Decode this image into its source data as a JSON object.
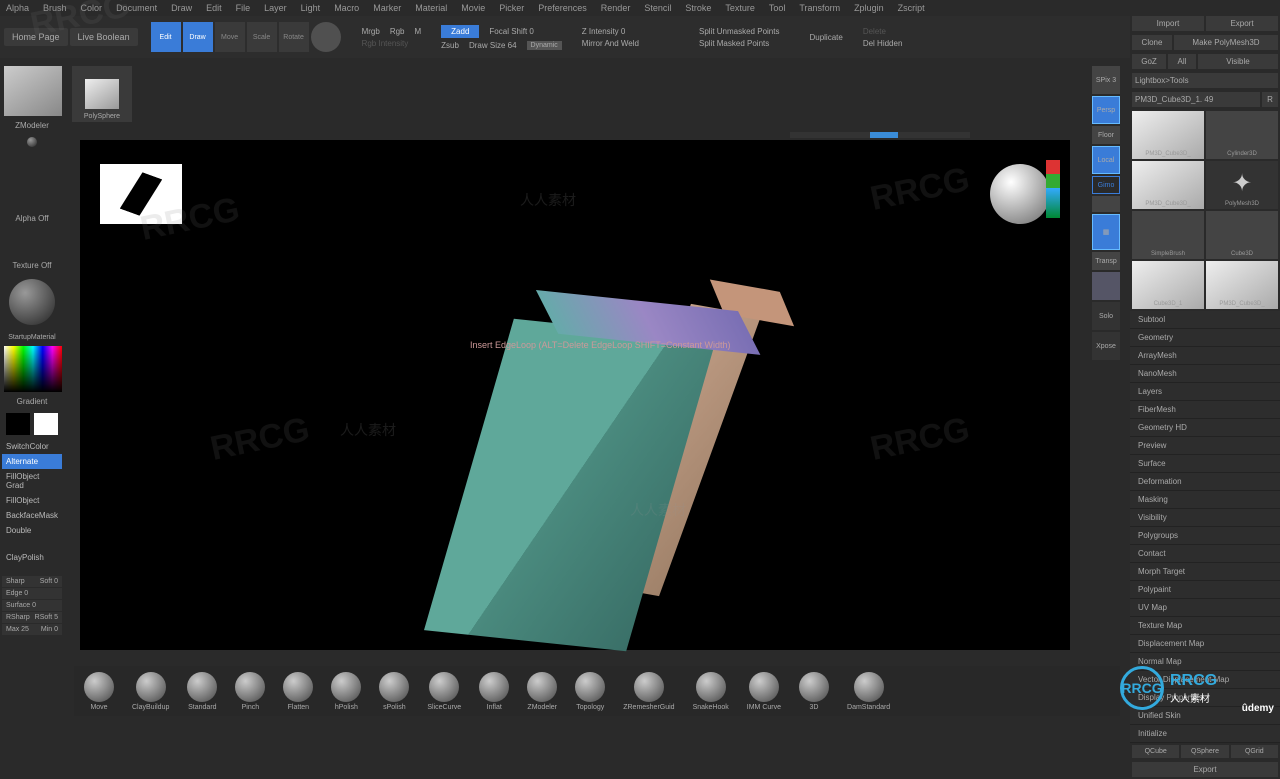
{
  "menu": [
    "Alpha",
    "Brush",
    "Color",
    "Document",
    "Draw",
    "Edit",
    "File",
    "Layer",
    "Light",
    "Macro",
    "Marker",
    "Material",
    "Movie",
    "Picker",
    "Preferences",
    "Render",
    "Stencil",
    "Stroke",
    "Texture",
    "Tool",
    "Transform",
    "Zplugin",
    "Zscript"
  ],
  "topbar": {
    "home": "Home Page",
    "live": "Live Boolean",
    "icons": [
      "Edit",
      "Draw",
      "Move",
      "Scale",
      "Rotate"
    ],
    "active_icons": [
      0,
      1
    ],
    "mrgb": "Mrgb",
    "rgb": "Rgb",
    "m": "M",
    "zadd": "Zadd",
    "zsub": "Zsub",
    "focal": "Focal Shift 0",
    "draw": "Draw Size 64",
    "dynamic": "Dynamic",
    "zint": "Z Intensity 0",
    "mirror": "Mirror And Weld",
    "split1": "Split Unmasked Points",
    "split2": "Split Masked Points",
    "dup": "Duplicate",
    "del": "Delete",
    "delh": "Del Hidden"
  },
  "left": {
    "tool": "ZModeler",
    "poly": "PolySphere",
    "alpha": "Alpha Off",
    "texture": "Texture Off",
    "material": "StartupMaterial",
    "gradient": "Gradient",
    "switch": "SwitchColor",
    "opts": [
      "Alternate",
      "FillObject Grad",
      "FillObject",
      "BackfaceMask",
      "Double"
    ],
    "claypolish": "ClayPolish",
    "sliders": [
      {
        "l": "Sharp",
        "r": "Soft 0"
      },
      {
        "l": "Edge 0",
        "r": ""
      },
      {
        "l": "Surface 0",
        "r": ""
      },
      {
        "l": "RSharp",
        "r": "RSoft 5"
      },
      {
        "l": "Max 25",
        "r": "Min 0"
      }
    ]
  },
  "canvas_tip": "Insert EdgeLoop (ALT=Delete EdgeLoop SHIFT=Constant Width)",
  "right_icons": {
    "spix": "SPix 3",
    "labels": [
      "Persp",
      "Floor",
      "Local",
      "Gimo",
      "Transp",
      "Solo",
      "Xpose"
    ]
  },
  "rightpanel": {
    "import": "Import",
    "export": "Export",
    "clone": "Clone",
    "make": "Make PolyMesh3D",
    "goz": "GoZ",
    "all": "All",
    "visible": "Visible",
    "lightbox": "Lightbox>Tools",
    "subtool": "PM3D_Cube3D_1. 49",
    "r": "R",
    "tools": [
      "PM3D_Cube3D_",
      "Cylinder3D",
      "PM3D_Cube3D_",
      "PolyMesh3D",
      "SimpleBrush",
      "Cube3D",
      "Cube3D_1",
      "PM3D_Cube3D_"
    ],
    "accordion": [
      "Subtool",
      "Geometry",
      "ArrayMesh",
      "NanoMesh",
      "Layers",
      "FiberMesh",
      "Geometry HD",
      "Preview",
      "Surface",
      "Deformation",
      "Masking",
      "Visibility",
      "Polygroups",
      "Contact",
      "Morph Target",
      "Polypaint",
      "UV Map",
      "Texture Map",
      "Displacement Map",
      "Normal Map",
      "Vector Displacement Map",
      "Display Properties",
      "Unified Skin",
      "Initialize"
    ],
    "bottom": [
      "QCube",
      "QSphere",
      "QGrid"
    ],
    "export2": "Export"
  },
  "brushes": [
    "Move",
    "ClayBuildup",
    "Standard",
    "Pinch",
    "Flatten",
    "hPolish",
    "sPolish",
    "SliceCurve",
    "Inflat",
    "ZModeler",
    "Topology",
    "ZRemesherGuid",
    "SnakeHook",
    "IMM Curve",
    "3D",
    "DamStandard"
  ],
  "logo": "RRCG",
  "logo_sub": "人人素材",
  "udemy": "ûdemy"
}
